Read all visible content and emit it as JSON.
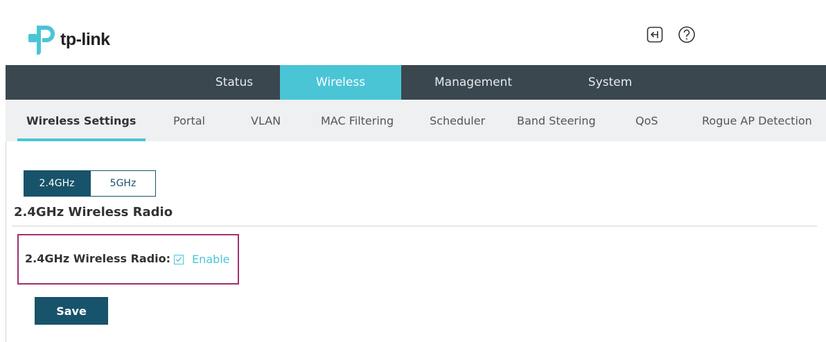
{
  "brand": {
    "logo_text": "tp-link",
    "accent": "#4ac5d6",
    "dark": "#17536a",
    "nav_bg": "#3a474f"
  },
  "header": {
    "icons": [
      "logout-icon",
      "help-icon"
    ]
  },
  "main_nav": {
    "tabs": [
      {
        "label": "Status",
        "active": false
      },
      {
        "label": "Wireless",
        "active": true
      },
      {
        "label": "Management",
        "active": false
      },
      {
        "label": "System",
        "active": false
      }
    ]
  },
  "sub_nav": {
    "tabs": [
      {
        "label": "Wireless Settings",
        "active": true
      },
      {
        "label": "Portal",
        "active": false
      },
      {
        "label": "VLAN",
        "active": false
      },
      {
        "label": "MAC Filtering",
        "active": false
      },
      {
        "label": "Scheduler",
        "active": false
      },
      {
        "label": "Band Steering",
        "active": false
      },
      {
        "label": "QoS",
        "active": false
      },
      {
        "label": "Rogue AP Detection",
        "active": false
      }
    ]
  },
  "band_toggle": {
    "options": [
      "2.4GHz",
      "5GHz"
    ],
    "selected": "2.4GHz"
  },
  "section": {
    "title": "2.4GHz Wireless Radio"
  },
  "radio_field": {
    "label": "2.4GHz Wireless Radio:",
    "checkbox_label": "Enable",
    "checked": true
  },
  "actions": {
    "save_label": "Save"
  }
}
